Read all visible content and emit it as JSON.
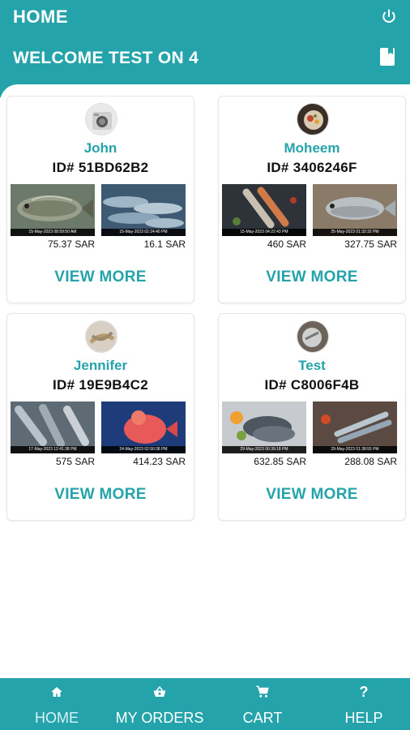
{
  "header": {
    "title": "HOME",
    "welcome": "WELCOME TEST ON 4"
  },
  "sellers": [
    {
      "name": "John",
      "id": "ID# 51BD62B2",
      "items": [
        {
          "stamp": "15-May-2023 08:59:50 AM",
          "price": "75.37 SAR"
        },
        {
          "stamp": "15-May-2023 02:24:40 PM",
          "price": "16.1 SAR"
        }
      ],
      "action": "VIEW MORE"
    },
    {
      "name": "Moheem",
      "id": "ID# 3406246F",
      "items": [
        {
          "stamp": "15-May-2023 04:22:43 PM",
          "price": "460 SAR"
        },
        {
          "stamp": "25-May-2023 01:32:32 PM",
          "price": "327.75 SAR"
        }
      ],
      "action": "VIEW MORE"
    },
    {
      "name": "Jennifer",
      "id": "ID# 19E9B4C2",
      "items": [
        {
          "stamp": "17-May-2023 12:41:38 PM",
          "price": "575 SAR"
        },
        {
          "stamp": "24-May-2023 02:50:38 PM",
          "price": "414.23 SAR"
        }
      ],
      "action": "VIEW MORE"
    },
    {
      "name": "Test",
      "id": "ID# C8006F4B",
      "items": [
        {
          "stamp": "29-May-2023 00:39:18 PM",
          "price": "632.85 SAR"
        },
        {
          "stamp": "29-May-2023 01:38:55 PM",
          "price": "288.08 SAR"
        }
      ],
      "action": "VIEW MORE"
    }
  ],
  "nav": {
    "home": "HOME",
    "orders": "MY ORDERS",
    "cart": "CART",
    "help": "HELP",
    "help_glyph": "?"
  },
  "icons": {
    "power": "power-icon",
    "document": "document-icon",
    "home": "home-icon",
    "orders": "basket-icon",
    "cart": "cart-icon",
    "help": "help-icon"
  },
  "colors": {
    "primary": "#25a3ab",
    "active_nav_label": "#d7f3f5"
  }
}
